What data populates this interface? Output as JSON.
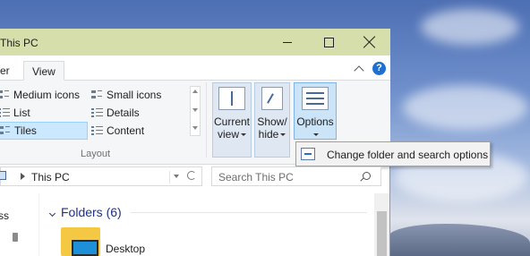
{
  "window": {
    "title": "This PC",
    "accent_color": "#d6dfab",
    "controls": {
      "minimize": "minimize",
      "maximize": "maximize",
      "close": "close"
    }
  },
  "tabs": [
    {
      "label": "er",
      "active": false
    },
    {
      "label": "View",
      "active": true
    }
  ],
  "ribbon": {
    "layout_group": {
      "label": "Layout",
      "items": [
        {
          "label": "Medium icons",
          "icon": "medium-icons-icon"
        },
        {
          "label": "Small icons",
          "icon": "small-icons-icon"
        },
        {
          "label": "List",
          "icon": "list-icon"
        },
        {
          "label": "Details",
          "icon": "details-icon"
        },
        {
          "label": "Tiles",
          "icon": "tiles-icon",
          "selected": true
        },
        {
          "label": "Content",
          "icon": "content-icon"
        }
      ]
    },
    "current_view": {
      "line1": "Current",
      "line2": "view"
    },
    "show_hide": {
      "line1": "Show/",
      "line2": "hide"
    },
    "options": {
      "label": "Options"
    }
  },
  "options_menu": {
    "item": "Change folder and search options"
  },
  "address": {
    "location": "This PC"
  },
  "search": {
    "placeholder": "Search This PC"
  },
  "nav_pane": {
    "partial_label": "ss"
  },
  "content": {
    "group_header": "Folders (6)",
    "items": [
      {
        "label": "Desktop"
      }
    ]
  }
}
